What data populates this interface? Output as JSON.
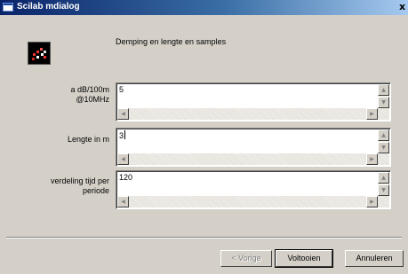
{
  "window": {
    "title": "Scilab mdialog",
    "close_glyph": "x"
  },
  "app_icon": "scilab-logo-icon",
  "heading": "Demping en lengte  en samples",
  "fields": [
    {
      "label": "a dB/100m\n@10MHz",
      "value": "5",
      "caret": false
    },
    {
      "label": "Lengte in m",
      "value": "3",
      "caret": true
    },
    {
      "label": "verdeling tijd per\nperiode",
      "value": "120",
      "caret": false
    }
  ],
  "buttons": {
    "prev": {
      "label": "< Vorige",
      "enabled": false
    },
    "finish": {
      "label": "Voltooien",
      "enabled": true
    },
    "cancel": {
      "label": "Annuleren",
      "enabled": true
    }
  },
  "colors": {
    "title_start": "#0a246a",
    "title_end": "#a6caf0",
    "face": "#d4d0c8"
  }
}
